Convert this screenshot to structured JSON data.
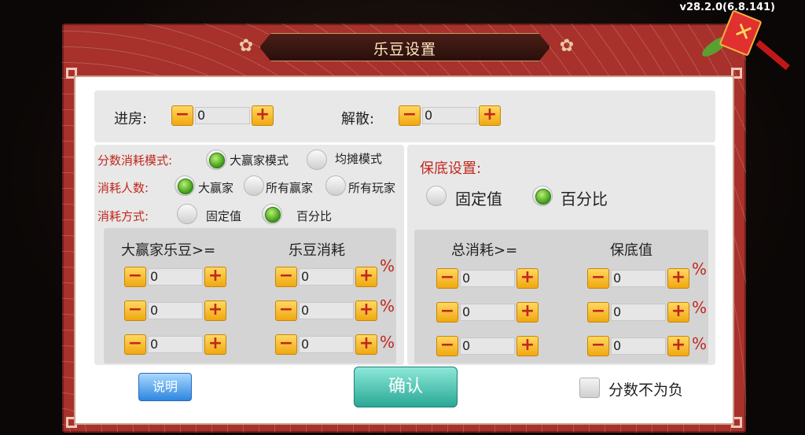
{
  "version": "v28.2.0(6.8.141)",
  "title": "乐豆设置",
  "top": {
    "enter_label": "进房:",
    "enter_value": "0",
    "dissolve_label": "解散:",
    "dissolve_value": "0"
  },
  "left": {
    "score_mode_label": "分数消耗模式:",
    "score_mode_options": [
      "大赢家模式",
      "均摊模式"
    ],
    "score_mode_selected": "大赢家模式",
    "consume_people_label": "消耗人数:",
    "consume_people_options": [
      "大赢家",
      "所有赢家",
      "所有玩家"
    ],
    "consume_people_selected": "大赢家",
    "consume_method_label": "消耗方式:",
    "consume_method_options": [
      "固定值",
      "百分比"
    ],
    "consume_method_selected": "百分比",
    "col1_header": "大赢家乐豆>=",
    "col2_header": "乐豆消耗",
    "rows": [
      {
        "threshold": "0",
        "cost": "0",
        "unit": "%"
      },
      {
        "threshold": "0",
        "cost": "0",
        "unit": "%"
      },
      {
        "threshold": "0",
        "cost": "0",
        "unit": "%"
      }
    ]
  },
  "right": {
    "guarantee_label": "保底设置:",
    "guarantee_options": [
      "固定值",
      "百分比"
    ],
    "guarantee_selected": "百分比",
    "col1_header": "总消耗>=",
    "col2_header": "保底值",
    "rows": [
      {
        "threshold": "0",
        "value": "0",
        "unit": "%"
      },
      {
        "threshold": "0",
        "value": "0",
        "unit": "%"
      },
      {
        "threshold": "0",
        "value": "0",
        "unit": "%"
      }
    ]
  },
  "footer": {
    "help_label": "说明",
    "confirm_label": "确认",
    "nonneg_label": "分数不为负",
    "nonneg_checked": false
  },
  "icons": {
    "minus": "−",
    "plus": "+",
    "close": "✕"
  },
  "colors": {
    "frame": "#a8312b",
    "accent_red": "#c0281e",
    "radio_on": "#3c9a18",
    "stepper": "#f0a810",
    "confirm": "#2aa896",
    "help": "#2d86e0"
  }
}
